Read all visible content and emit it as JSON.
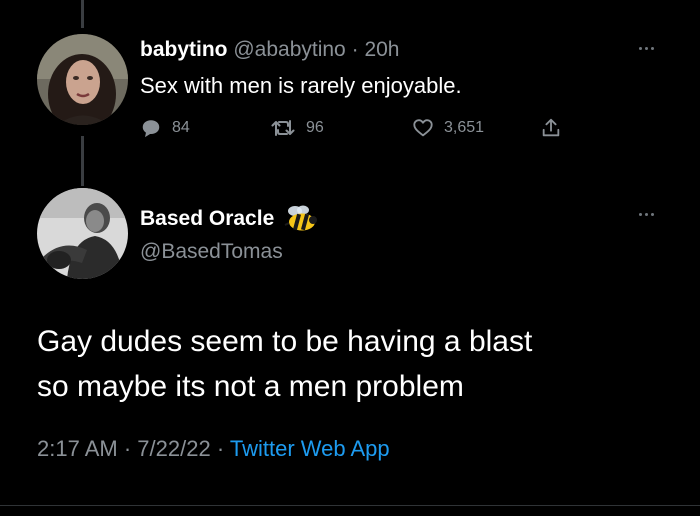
{
  "reply_tweet": {
    "display_name": "babytino",
    "handle": "@ababytino",
    "separator": "·",
    "time_ago": "20h",
    "text": "Sex with men is rarely enjoyable.",
    "replies": "84",
    "retweets": "96",
    "likes": "3,651"
  },
  "main_tweet": {
    "display_name": "Based Oracle",
    "badge_icon": "bee-emoji-icon",
    "handle": "@BasedTomas",
    "text_line_1": "Gay dudes seem to be having a blast",
    "text_line_2": "so maybe its not a men problem",
    "time": "2:17 AM",
    "separator_1": "·",
    "date": "7/22/22",
    "separator_2": "·",
    "source": "Twitter Web App"
  },
  "colors": {
    "background": "#000000",
    "text": "#ffffff",
    "muted": "#8b9197",
    "link": "#1d9bf0",
    "divider": "#2f3336"
  }
}
